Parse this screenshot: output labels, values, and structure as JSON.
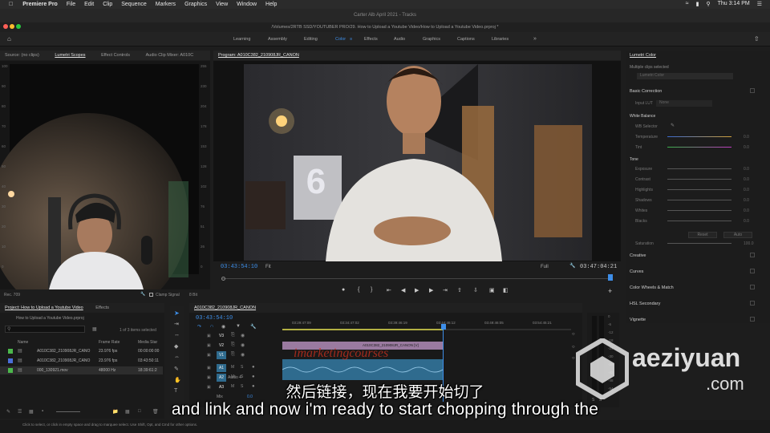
{
  "menubar": {
    "app": "Premiere Pro",
    "items": [
      "File",
      "Edit",
      "Clip",
      "Sequence",
      "Markers",
      "Graphics",
      "View",
      "Window",
      "Help"
    ],
    "clock": "Thu 3:14 PM"
  },
  "window": {
    "title": "Carter Alb April 2021 - Tracks",
    "path": "/Volumes/2RTB SSD/YOUTUBER PRO/29. How to Upload a Youtube Video/How to Upload a Youtube Video.prproj *"
  },
  "workspaces": [
    "Learning",
    "Assembly",
    "Editing",
    "Color",
    "Effects",
    "Audio",
    "Graphics",
    "Captions",
    "Libraries"
  ],
  "active_workspace": "Color",
  "source_panel": {
    "tabs": [
      "Source: (no clips)",
      "Lumetri Scopes",
      "Effect Controls",
      "Audio Clip Mixer: A010C"
    ],
    "active_tab": "Lumetri Scopes",
    "scale_left": [
      "100",
      "90",
      "80",
      "70",
      "60",
      "50",
      "40",
      "30",
      "20",
      "10",
      "0"
    ],
    "scale_right": [
      "255",
      "230",
      "204",
      "178",
      "153",
      "128",
      "102",
      "76",
      "51",
      "26",
      "0"
    ],
    "footer_left": "Rec. 709",
    "clamp": "Clamp Signal",
    "bit": "8 Bit"
  },
  "program_panel": {
    "title": "Program: A010C382_210908JR_CANON",
    "timecode": "03:43:54:10",
    "fit": "Fit",
    "quality": "Full",
    "duration": "03:47:04:21",
    "video_numeral": "6"
  },
  "lumetri": {
    "title": "Lumetri Color",
    "multi": "Multiple clips selected",
    "clip_name": "Lumetri Color",
    "basic": "Basic Correction",
    "input_lut": "Input LUT",
    "lut_value": "None",
    "white_balance": "White Balance",
    "wb_selector": "WB Selector",
    "temperature": "Temperature",
    "tint": "Tint",
    "tone": "Tone",
    "tone_rows": [
      "Exposure",
      "Contrast",
      "Highlights",
      "Shadows",
      "Whites",
      "Blacks"
    ],
    "value": "0.0",
    "reset": "Reset",
    "auto": "Auto",
    "saturation": "Saturation",
    "saturation_value": "100.0",
    "sections": [
      "Creative",
      "Curves",
      "Color Wheels & Match",
      "HSL Secondary",
      "Vignette"
    ]
  },
  "project": {
    "tabs": [
      "Project: How to Upload a Youtube Video",
      "Effects"
    ],
    "file": "How to Upload a Youtube Video.prproj",
    "count": "1 of 3 items selected",
    "columns": [
      "Name",
      "Frame Rate",
      "Media Star"
    ],
    "rows": [
      {
        "name": "A010C382_210908JR_CANO",
        "fps": "23.976 fps",
        "start": "00:00:00:00",
        "color": "#4cb84c"
      },
      {
        "name": "A010C382_210908JR_CANO",
        "fps": "23.976 fps",
        "start": "03:43:50:11",
        "color": "#4a6ed8"
      },
      {
        "name": "000_130921.mov",
        "fps": "48000 Hz",
        "start": "18:39:61:2",
        "color": "#4cb84c"
      }
    ]
  },
  "timeline": {
    "title": "A010C382_210908JR_CANON",
    "timecode": "03:43:54:10",
    "ruler": [
      "03:29:47:09",
      "03:34:47:02",
      "03:39:46:19",
      "03:44:46:12",
      "03:49:46:05",
      "03:54:45:21"
    ],
    "tracks": [
      "V3",
      "V2",
      "V1",
      "A1",
      "A2",
      "A3"
    ],
    "audio_label": "Audio 4",
    "mix": "Mix",
    "mix_value": "0.0",
    "clip_label": "A010C382_210908JR_CANON [V]",
    "meter_scale": [
      "0",
      "-6",
      "-12",
      "-18",
      "-24",
      "-30",
      "-36",
      "-42",
      "-48",
      "-54"
    ],
    "meter_labels": [
      "S",
      "S"
    ]
  },
  "status_bar": "Click to select, or click in empty space and drag to marquee select. Use Shift, Opt, and Cmd for other options.",
  "subtitles": {
    "zh": "然后链接，现在我要开始切了",
    "en": "and link and now i'm ready to start chopping through the"
  },
  "watermark": {
    "text": "aeziyuan",
    "sub": ".com",
    "overlay": "imarketingcourses"
  }
}
